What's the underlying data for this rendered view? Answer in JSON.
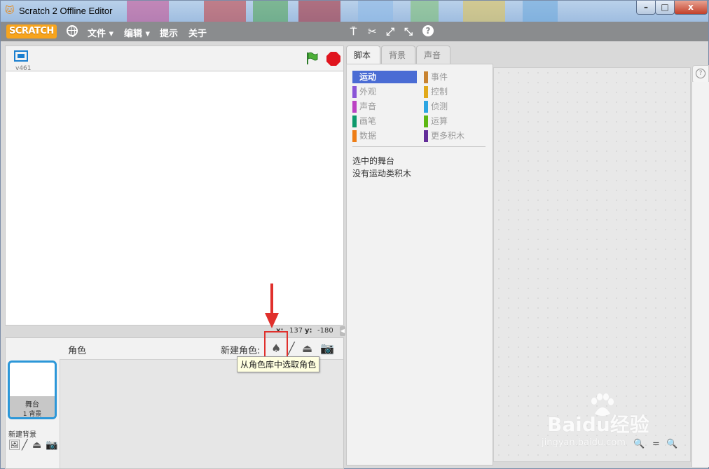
{
  "window": {
    "title": "Scratch 2 Offline Editor",
    "min_label": "–",
    "max_label": "□",
    "close_label": "x"
  },
  "menubar": {
    "logo": "SCRATCH",
    "items": [
      "文件 ▾",
      "编辑 ▾",
      "提示",
      "关于"
    ]
  },
  "stage": {
    "version": "v461",
    "x_label": "x:",
    "x_value": "137",
    "y_label": "y:",
    "y_value": "-180"
  },
  "sprites": {
    "header": "角色",
    "new_sprite": "新建角色:",
    "tooltip": "从角色库中选取角色",
    "stage_name": "舞台",
    "stage_count": "1 背景",
    "new_backdrop": "新建背景"
  },
  "tabs": [
    "脚本",
    "背景",
    "声音"
  ],
  "categories": {
    "left": [
      {
        "label": "运动",
        "color": "#4a6cd4"
      },
      {
        "label": "外观",
        "color": "#8a55d7"
      },
      {
        "label": "声音",
        "color": "#bb42c3"
      },
      {
        "label": "画笔",
        "color": "#0e9a6c"
      },
      {
        "label": "数据",
        "color": "#ee7d16"
      }
    ],
    "right": [
      {
        "label": "事件",
        "color": "#c88330"
      },
      {
        "label": "控制",
        "color": "#e1a91a"
      },
      {
        "label": "侦测",
        "color": "#2ca5e2"
      },
      {
        "label": "运算",
        "color": "#5cb712"
      },
      {
        "label": "更多积木",
        "color": "#632d99"
      }
    ]
  },
  "palette": {
    "line1": "选中的舞台",
    "line2": "没有运动类积木"
  },
  "watermark": {
    "main": "Baidu经验",
    "sub": "jingyan.baidu.com"
  }
}
